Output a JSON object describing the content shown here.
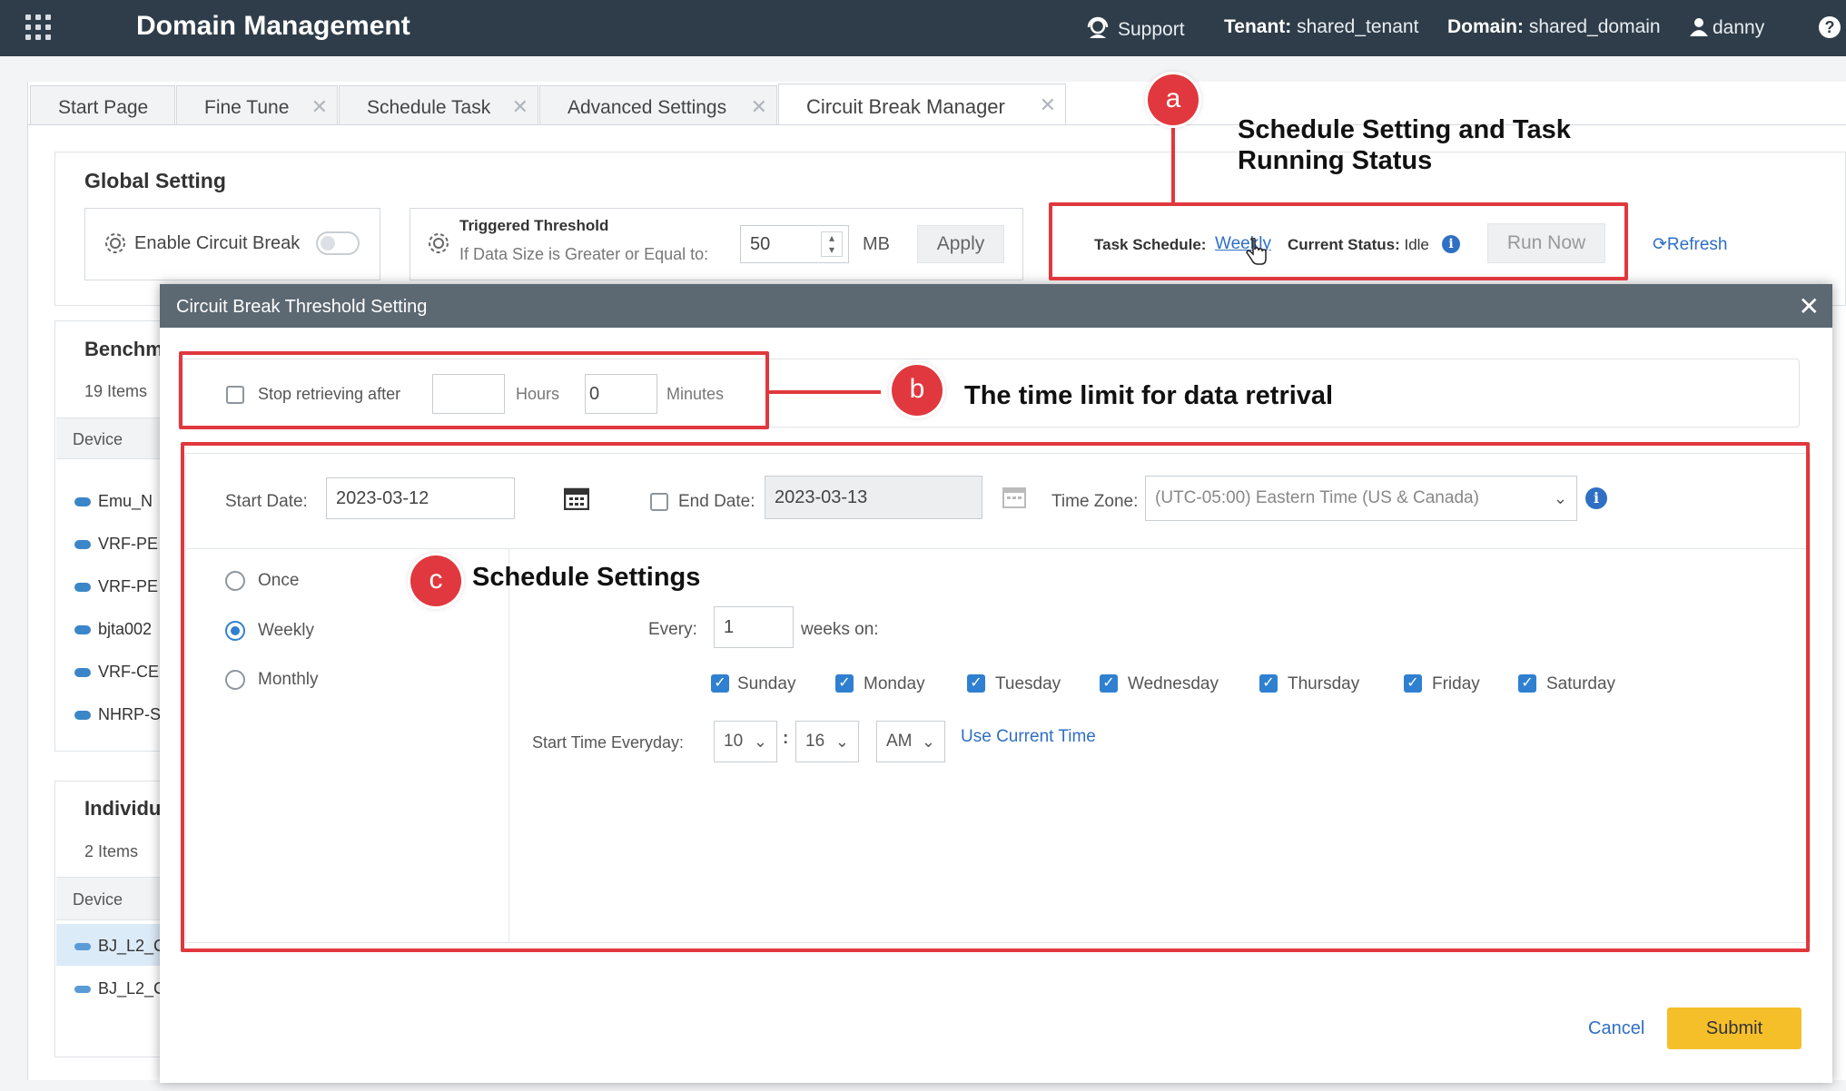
{
  "header": {
    "title": "Domain Management",
    "support": "Support",
    "tenant_label": "Tenant:",
    "tenant_value": "shared_tenant",
    "domain_label": "Domain:",
    "domain_value": "shared_domain",
    "user": "danny",
    "help": "?"
  },
  "tabs": [
    {
      "label": "Start Page",
      "active": false,
      "closable": false
    },
    {
      "label": "Fine Tune",
      "active": false,
      "closable": true
    },
    {
      "label": "Schedule Task",
      "active": false,
      "closable": true
    },
    {
      "label": "Advanced Settings",
      "active": false,
      "closable": true
    },
    {
      "label": "Circuit Break Manager",
      "active": true,
      "closable": true
    }
  ],
  "global_setting": {
    "title": "Global Setting",
    "enable_label": "Enable Circuit Break",
    "enabled": false,
    "threshold_title": "Triggered Threshold",
    "threshold_desc": "If Data Size is Greater or Equal to:",
    "threshold_value": "50",
    "threshold_unit": "MB",
    "apply": "Apply",
    "task_schedule_label": "Task Schedule:",
    "task_schedule_value": "Weekly",
    "status_label": "Current Status:",
    "status_value": "Idle",
    "run_now": "Run Now",
    "refresh": "Refresh"
  },
  "benchmark": {
    "title": "Benchm",
    "count": "19 Items",
    "column": "Device",
    "rows": [
      "Emu_N",
      "VRF-PE",
      "VRF-PE",
      "bjta002",
      "VRF-CE",
      "NHRP-S"
    ]
  },
  "individual": {
    "title": "Individu",
    "count": "2 Items",
    "column": "Device",
    "rows": [
      "BJ_L2_C",
      "BJ_L2_C"
    ]
  },
  "modal": {
    "title": "Circuit Break Threshold Setting",
    "close": "✕",
    "stop_label": "Stop retrieving after",
    "stop_checked": false,
    "hours_value": "",
    "hours_label": "Hours",
    "minutes_value": "0",
    "minutes_label": "Minutes",
    "start_date_label": "Start Date:",
    "start_date": "2023-03-12",
    "end_date_label": "End Date:",
    "end_date_checked": false,
    "end_date": "2023-03-13",
    "timezone_label": "Time Zone:",
    "timezone": "(UTC-05:00) Eastern Time (US & Canada)",
    "frequency_options": [
      {
        "label": "Once",
        "checked": false
      },
      {
        "label": "Weekly",
        "checked": true
      },
      {
        "label": "Monthly",
        "checked": false
      }
    ],
    "every_label": "Every:",
    "every_value": "1",
    "weeks_on": "weeks on:",
    "days": [
      {
        "label": "Sunday",
        "checked": true
      },
      {
        "label": "Monday",
        "checked": true
      },
      {
        "label": "Tuesday",
        "checked": true
      },
      {
        "label": "Wednesday",
        "checked": true
      },
      {
        "label": "Thursday",
        "checked": true
      },
      {
        "label": "Friday",
        "checked": true
      },
      {
        "label": "Saturday",
        "checked": true
      }
    ],
    "start_time_label": "Start Time Everyday:",
    "hour": "10",
    "minute": "16",
    "ampm": "AM",
    "use_current": "Use Current Time",
    "cancel": "Cancel",
    "submit": "Submit"
  },
  "annotations": {
    "a_letter": "a",
    "a_text_1": "Schedule Setting and Task",
    "a_text_2": "Running Status",
    "b_letter": "b",
    "b_text": "The time limit for data retrival",
    "c_letter": "c",
    "c_text": "Schedule Settings"
  },
  "colors": {
    "topbar": "#2f3d4a",
    "accent": "#2f80d1",
    "annotation_red": "#e0383e",
    "submit": "#f5bf2a"
  }
}
